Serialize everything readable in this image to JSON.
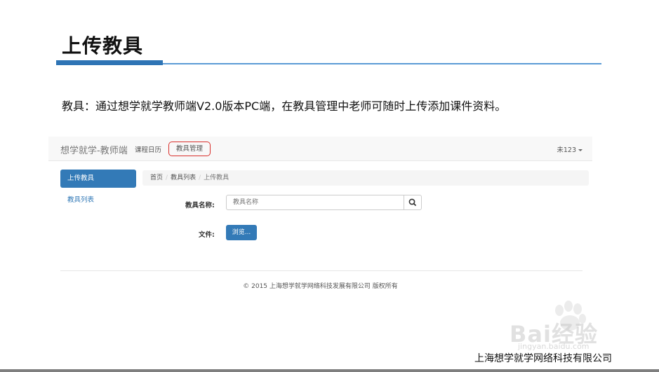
{
  "slide": {
    "title": "上传教具",
    "description": "教具：通过想学就学教师端V2.0版本PC端，在教具管理中老师可随时上传添加课件资料。",
    "company": "上海想学就学网络科技有限公司",
    "accent_color": "#2e74b5"
  },
  "app": {
    "brand": "想学就学-教师端",
    "nav": {
      "course_calendar": "课程日历",
      "teaching_tools": "教具管理",
      "user": "未123"
    },
    "sidebar": {
      "active_item": "上传教具",
      "item_list": "教具列表"
    },
    "breadcrumb": {
      "home": "首页",
      "list": "教具列表",
      "current": "上传教具"
    },
    "form": {
      "name_label": "教具名称:",
      "name_placeholder": "教具名称",
      "file_label": "文件:",
      "browse_label": "浏览..."
    },
    "footer": "© 2015 上海想学就学网络科技发展有限公司 版权所有",
    "primary_color": "#337ab7",
    "highlight_color": "#d9302c",
    "icons": {
      "search": "search-icon",
      "caret": "caret-down-icon"
    }
  },
  "watermark": {
    "logo": "Bai经验",
    "url": "jingyan.baidu.com"
  }
}
